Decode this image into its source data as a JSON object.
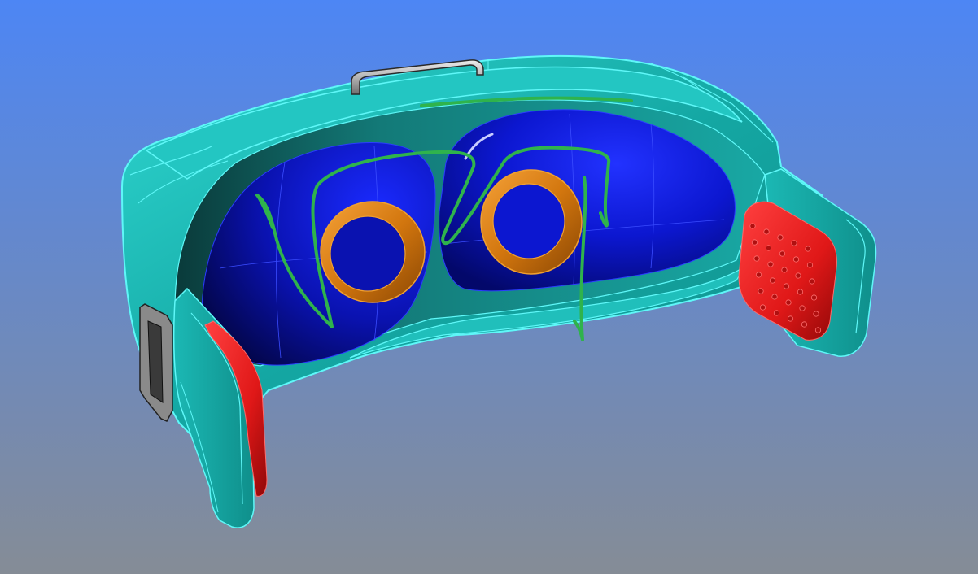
{
  "viewport": {
    "background_top": "#4d86f4",
    "background_bottom": "#858c96"
  },
  "colors": {
    "shell": "#14a7a3",
    "shell_light": "#2ed6d0",
    "edge": "#5ff7f8",
    "foam_pad": "#0c17d0",
    "foam_pad_dark": "#03086a",
    "lens_ring": "#d2760e",
    "heat_pad": "#e01818",
    "strap_bar": "#b5b5b5",
    "sketch_stroke": "#2fb34c"
  }
}
